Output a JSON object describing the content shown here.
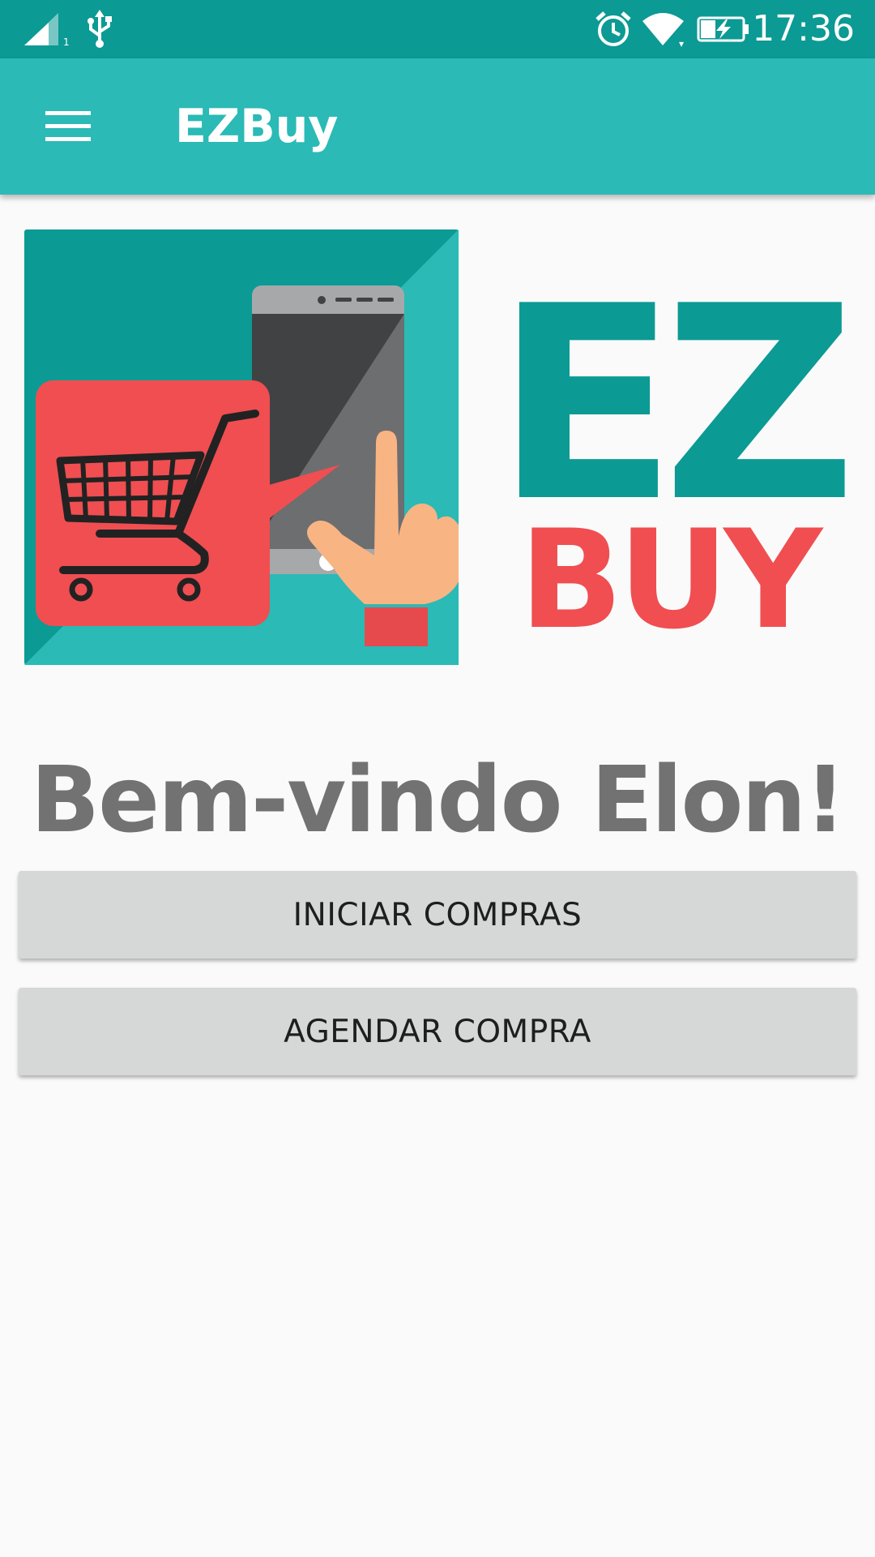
{
  "status_bar": {
    "time": "17:36",
    "icons": [
      "signal-icon",
      "usb-icon",
      "alarm-icon",
      "wifi-icon",
      "battery-charging-icon"
    ]
  },
  "app_bar": {
    "title": "EZBuy",
    "menu_icon": "hamburger-menu-icon"
  },
  "logo": {
    "wordmark_top": "EZ",
    "wordmark_bottom": "BUY",
    "illustration": "shopping-cart-phone-hand"
  },
  "main": {
    "welcome_text": "Bem-vindo Elon!",
    "buttons": [
      {
        "label": "INICIAR COMPRAS"
      },
      {
        "label": "AGENDAR COMPRA"
      }
    ]
  },
  "colors": {
    "status_bar": "#0c9a94",
    "app_bar": "#2bbab6",
    "brand_teal": "#0c9a94",
    "brand_red": "#f04e51",
    "background": "#fafafa",
    "button": "#d6d7d7",
    "welcome_text": "#727272"
  }
}
